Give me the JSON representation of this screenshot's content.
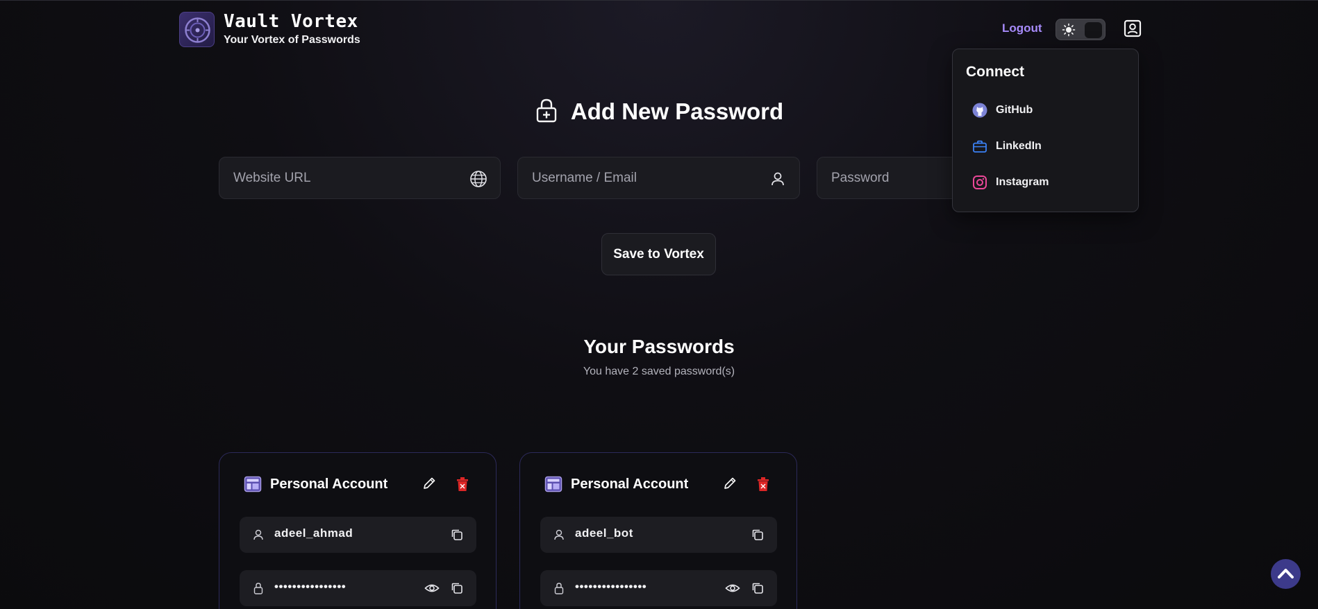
{
  "header": {
    "brand_name": "Vault Vortex",
    "tagline": "Your Vortex of Passwords",
    "logout_label": "Logout",
    "theme_toggle": "light-dark",
    "profile_icon": "profile-icon"
  },
  "connect_menu": {
    "title": "Connect",
    "items": [
      {
        "label": "GitHub",
        "icon": "github-icon",
        "color": "#7c83d6"
      },
      {
        "label": "LinkedIn",
        "icon": "briefcase-icon",
        "color": "#3b82f6"
      },
      {
        "label": "Instagram",
        "icon": "instagram-icon",
        "color": "#ec4899"
      }
    ]
  },
  "add_form": {
    "title": "Add New Password",
    "website_placeholder": "Website URL",
    "username_placeholder": "Username / Email",
    "password_placeholder": "Password",
    "save_label": "Save to Vortex"
  },
  "passwords_section": {
    "title": "Your Passwords",
    "subtitle": "You have 2 saved password(s)"
  },
  "cards": [
    {
      "site": "Personal Account",
      "username": "adeel_ahmad",
      "password_mask": "••••••••••••••••"
    },
    {
      "site": "Personal Account",
      "username": "adeel_bot",
      "password_mask": "••••••••••••••••"
    }
  ],
  "colors": {
    "accent": "#a78bfa",
    "card_border": "#2c2a5a",
    "delete": "#dc2626",
    "scroll_top": "#3c3a8a"
  }
}
